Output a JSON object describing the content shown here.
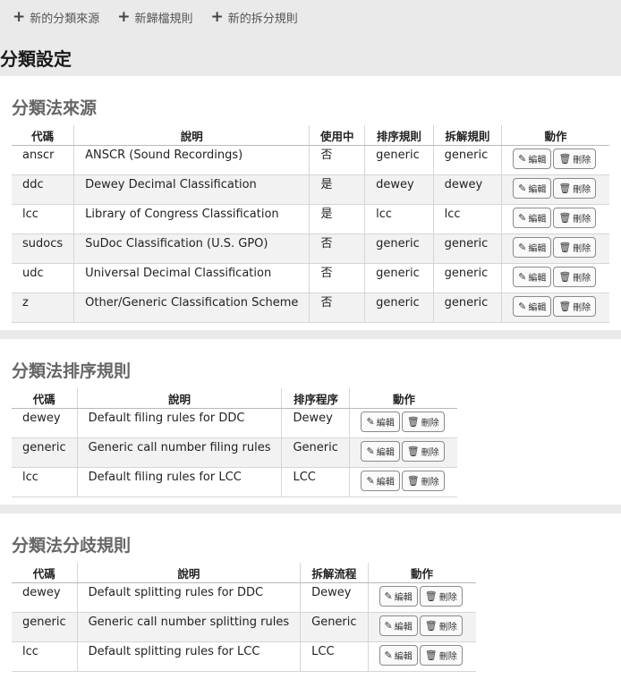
{
  "toolbar": {
    "new_source": "新的分類來源",
    "new_filing": "新歸檔規則",
    "new_split": "新的拆分規則"
  },
  "page_title": "分類設定",
  "sources": {
    "title": "分類法來源",
    "headers": [
      "代碼",
      "說明",
      "使用中",
      "排序規則",
      "拆解規則",
      "動作"
    ],
    "rows": [
      {
        "code": "anscr",
        "desc": "ANSCR (Sound Recordings)",
        "in_use": "否",
        "filing": "generic",
        "split": "generic"
      },
      {
        "code": "ddc",
        "desc": "Dewey Decimal Classification",
        "in_use": "是",
        "filing": "dewey",
        "split": "dewey"
      },
      {
        "code": "lcc",
        "desc": "Library of Congress Classification",
        "in_use": "是",
        "filing": "lcc",
        "split": "lcc"
      },
      {
        "code": "sudocs",
        "desc": "SuDoc Classification (U.S. GPO)",
        "in_use": "否",
        "filing": "generic",
        "split": "generic"
      },
      {
        "code": "udc",
        "desc": "Universal Decimal Classification",
        "in_use": "否",
        "filing": "generic",
        "split": "generic"
      },
      {
        "code": "z",
        "desc": "Other/Generic Classification Scheme",
        "in_use": "否",
        "filing": "generic",
        "split": "generic"
      }
    ]
  },
  "filing": {
    "title": "分類法排序規則",
    "headers": [
      "代碼",
      "說明",
      "排序程序",
      "動作"
    ],
    "rows": [
      {
        "code": "dewey",
        "desc": "Default filing rules for DDC",
        "routine": "Dewey"
      },
      {
        "code": "generic",
        "desc": "Generic call number filing rules",
        "routine": "Generic"
      },
      {
        "code": "lcc",
        "desc": "Default filing rules for LCC",
        "routine": "LCC"
      }
    ]
  },
  "splitting": {
    "title": "分類法分歧規則",
    "headers": [
      "代碼",
      "說明",
      "拆解流程",
      "動作"
    ],
    "rows": [
      {
        "code": "dewey",
        "desc": "Default splitting rules for DDC",
        "routine": "Dewey"
      },
      {
        "code": "generic",
        "desc": "Generic call number splitting rules",
        "routine": "Generic"
      },
      {
        "code": "lcc",
        "desc": "Default splitting rules for LCC",
        "routine": "LCC"
      }
    ]
  },
  "actions": {
    "edit": "編輯",
    "delete": "刪除"
  },
  "icons": {
    "edit": "pencil-icon",
    "delete": "trash-icon",
    "add": "plus-icon"
  }
}
